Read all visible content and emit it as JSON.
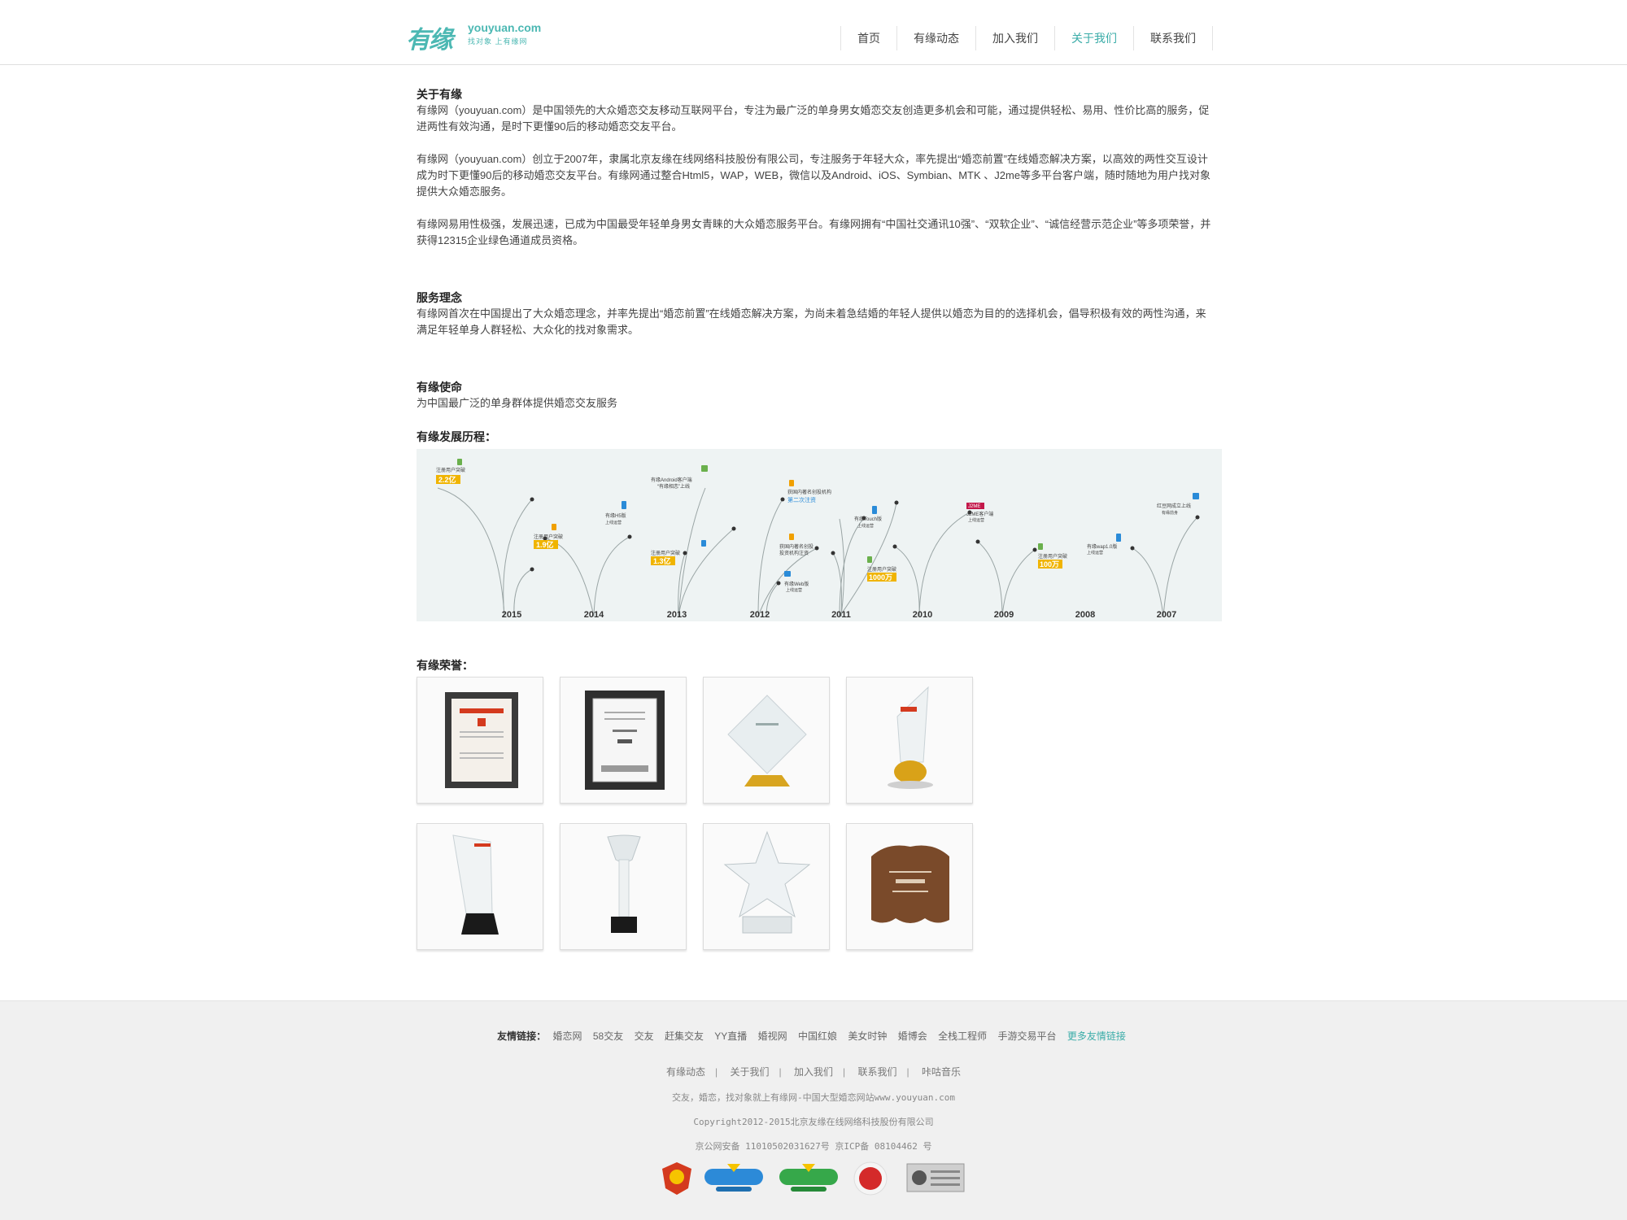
{
  "header": {
    "logo_mark": "有缘",
    "logo_domain": "youyuan.com",
    "logo_slogan": "找对象 上有缘网",
    "nav": [
      {
        "label": "首页"
      },
      {
        "label": "有缘动态"
      },
      {
        "label": "加入我们"
      },
      {
        "label": "关于我们",
        "active": true
      },
      {
        "label": "联系我们"
      }
    ]
  },
  "about": {
    "title": "关于有缘",
    "p1": "有缘网（youyuan.com）是中国领先的大众婚恋交友移动互联网平台，专注为最广泛的单身男女婚恋交友创造更多机会和可能，通过提供轻松、易用、性价比高的服务，促进两性有效沟通，是时下更懂90后的移动婚恋交友平台。",
    "p2": "有缘网（youyuan.com）创立于2007年，隶属北京友缘在线网络科技股份有限公司，专注服务于年轻大众，率先提出“婚恋前置”在线婚恋解决方案，以高效的两性交互设计成为时下更懂90后的移动婚恋交友平台。有缘网通过整合Html5，WAP，WEB，微信以及Android、iOS、Symbian、MTK 、J2me等多平台客户端，随时随地为用户找对象提供大众婚恋服务。",
    "p3": "有缘网易用性极强，发展迅速，已成为中国最受年轻单身男女青睐的大众婚恋服务平台。有缘网拥有“中国社交通讯10强”、“双软企业”、“诚信经营示范企业”等多项荣誉，并获得12315企业绿色通道成员资格。"
  },
  "service": {
    "title": "服务理念",
    "p": "有缘网首次在中国提出了大众婚恋理念，并率先提出“婚恋前置”在线婚恋解决方案，为尚未着急结婚的年轻人提供以婚恋为目的的选择机会，倡导积极有效的两性沟通，来满足年轻单身人群轻松、大众化的找对象需求。"
  },
  "mission": {
    "title": "有缘使命",
    "p": "为中国最广泛的单身群体提供婚恋交友服务"
  },
  "timeline": {
    "title": "有缘发展历程：",
    "years": [
      "2015",
      "2014",
      "2013",
      "2012",
      "2011",
      "2010",
      "2009",
      "2008",
      "2007"
    ],
    "events": [
      {
        "label": "注册用户突破",
        "value": "2.2亿",
        "color": "#f0b400"
      },
      {
        "label": "注册用户突破",
        "value": "1.9亿",
        "color": "#f0b400"
      },
      {
        "label": "有缘H5版",
        "sub": "上线运营"
      },
      {
        "label": "有缘Android客户端",
        "sub": "“有缘相恋”上线"
      },
      {
        "label": "注册用户突破",
        "value": "1.3亿",
        "color": "#f0b400"
      },
      {
        "label": "获国内著名创投机构",
        "value": "第二次注资",
        "color": "#2a8bd8"
      },
      {
        "label": "获国内著名创投投资机构",
        "value": "注资",
        "color": "#2a8bd8"
      },
      {
        "label": "有缘Web版",
        "sub": "上线运营"
      },
      {
        "label": "有缘Touch版",
        "sub": "上线运营"
      },
      {
        "label": "注册用户突破",
        "value": "1000万",
        "color": "#f0b400"
      },
      {
        "label": "J2ME",
        "sub": "上线运营"
      },
      {
        "label": "注册用户突破",
        "value": "100万",
        "color": "#f0b400"
      },
      {
        "label": "有缘wap1.0版",
        "sub": "上线运营"
      },
      {
        "label": "红豆网成立上线",
        "sub": "有缘前身"
      }
    ]
  },
  "honors": {
    "title": "有缘荣誉："
  },
  "footer": {
    "friend_links_label": "友情链接：",
    "friend_links": [
      "婚恋网",
      "58交友",
      "交友",
      "赶集交友",
      "YY直播",
      "婚视网",
      "中国红娘",
      "美女时钟",
      "婚博会",
      "全栈工程师",
      "手游交易平台"
    ],
    "more_links": "更多友情链接",
    "nav": [
      "有缘动态",
      "关于我们",
      "加入我们",
      "联系我们",
      "咔咕音乐"
    ],
    "tagline": "交友，婚恋，找对象就上有缘网-中国大型婚恋网站www.youyuan.com",
    "copyright": "Copyright2012-2015北京友缘在线网络科技股份有限公司",
    "icp": "京公网安备 11010502031627号 京ICP备 08104462 号",
    "badges": [
      {
        "name": "工商",
        "color": "#d43a1e"
      },
      {
        "name": "安全V联盟 实名验证",
        "color": "#2c8ad8"
      },
      {
        "name": "安全V联盟 行业验证",
        "color": "#36a84a"
      },
      {
        "name": "信",
        "color": "#d42a2a"
      },
      {
        "name": "网络认证",
        "color": "#777777"
      }
    ]
  }
}
